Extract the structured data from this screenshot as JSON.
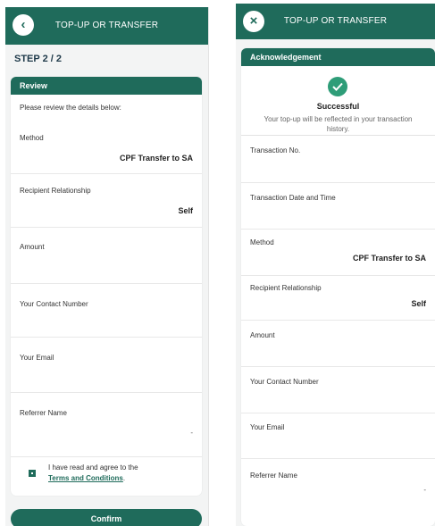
{
  "left": {
    "header_title": "TOP-UP OR TRANSFER",
    "step": "STEP 2 / 2",
    "card_title": "Review",
    "intro": "Please review the details below:",
    "fields": [
      {
        "label": "Method",
        "value": "CPF Transfer to SA"
      },
      {
        "label": "Recipient Relationship",
        "value": "Self"
      },
      {
        "label": "Amount",
        "value": ""
      },
      {
        "label": "Your Contact Number",
        "value": ""
      },
      {
        "label": "Your Email",
        "value": ""
      },
      {
        "label": "Referrer Name",
        "value": ""
      }
    ],
    "agree_text": "I have read and agree to the",
    "terms_link": "Terms and Conditions",
    "agree_suffix": ".",
    "confirm_label": "Confirm",
    "back_icon": "chevron-left-icon",
    "caret": "-"
  },
  "right": {
    "header_title": "TOP-UP OR TRANSFER",
    "card_title": "Acknowledgement",
    "success_title": "Successful",
    "success_msg": "Your top-up will be reflected in your transaction history.",
    "fields": [
      {
        "label": "Transaction No.",
        "value": ""
      },
      {
        "label": "Transaction Date and Time",
        "value": ""
      },
      {
        "label": "Method",
        "value": "CPF Transfer to SA"
      },
      {
        "label": "Recipient Relationship",
        "value": "Self"
      },
      {
        "label": "Amount",
        "value": ""
      },
      {
        "label": "Your Contact Number",
        "value": ""
      },
      {
        "label": "Your Email",
        "value": ""
      },
      {
        "label": "Referrer Name",
        "value": ""
      }
    ],
    "close_icon": "close-icon",
    "caret": "-"
  },
  "colors": {
    "brand": "#1f6b5b",
    "success": "#2e9d78",
    "background": "#f3f4f4"
  }
}
